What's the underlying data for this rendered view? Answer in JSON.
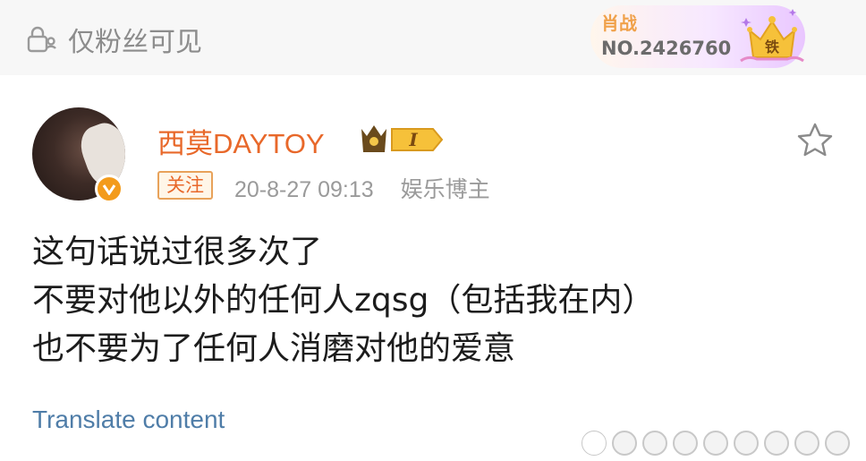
{
  "header": {
    "visibility_label": "仅粉丝可见",
    "fan_badge": {
      "name": "肖战",
      "number": "NO.2426760",
      "level_char": "铁"
    }
  },
  "post": {
    "username": "西莫DAYTOY",
    "vip_level": "I",
    "follow_label": "关注",
    "timestamp": "20-8-27 09:13",
    "category": "娱乐博主",
    "lines": [
      "这句话说过很多次了",
      "不要对他以外的任何人zqsg（包括我在内）",
      "也不要为了任何人消磨对他的爱意"
    ],
    "translate_label": "Translate content"
  },
  "colors": {
    "username": "#e8682a",
    "link": "#4f7da8",
    "verified": "#f39b1b"
  }
}
